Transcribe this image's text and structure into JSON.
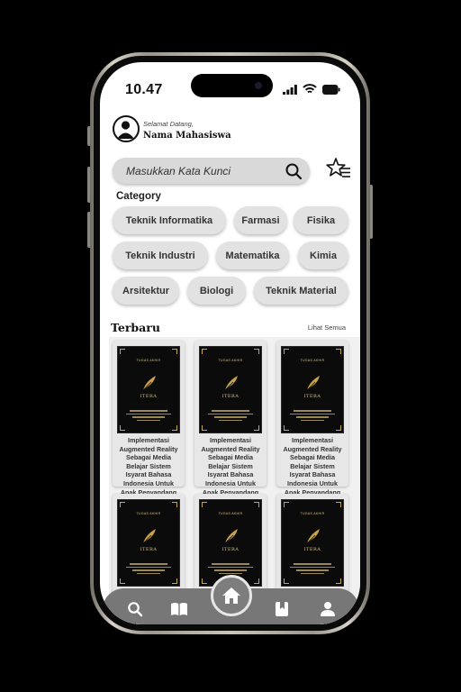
{
  "status_bar": {
    "time": "10.47"
  },
  "header": {
    "greeting": "Selamat Datang,",
    "user_name": "Nama Mahasiswa"
  },
  "search": {
    "placeholder": "Masukkan Kata Kunci"
  },
  "category": {
    "title": "Category",
    "items": [
      "Teknik Informatika",
      "Farmasi",
      "Fisika",
      "Teknik Industri",
      "Matematika",
      "Kimia",
      "Arsitektur",
      "Biologi",
      "Teknik Material"
    ]
  },
  "latest": {
    "title": "Terbaru",
    "see_all": "Lihat Semua",
    "cover": {
      "top_label": "TUGAS AKHIR",
      "brand": "ITERA"
    },
    "books": [
      {
        "title": "Implementasi Augmented Reality Sebagai Media Belajar Sistem Isyarat Bahasa Indonesia Untuk Anak Penyandang Tuli....."
      },
      {
        "title": "Implementasi Augmented Reality Sebagai Media Belajar Sistem Isyarat Bahasa Indonesia Untuk Anak Penyandang Tuli....."
      },
      {
        "title": "Implementasi Augmented Reality Sebagai Media Belajar Sistem Isyarat Bahasa Indonesia Untuk Anak Penyandang Tuli....."
      },
      {
        "title": ""
      },
      {
        "title": ""
      },
      {
        "title": ""
      }
    ]
  },
  "nav": {
    "items": [
      "search-icon",
      "book-open-icon",
      "home-icon",
      "bookmark-icon",
      "user-icon"
    ]
  },
  "colors": {
    "accent_gold": "#c9a34a",
    "nav_bg": "#777777",
    "chip_bg": "#e2e2e2"
  }
}
